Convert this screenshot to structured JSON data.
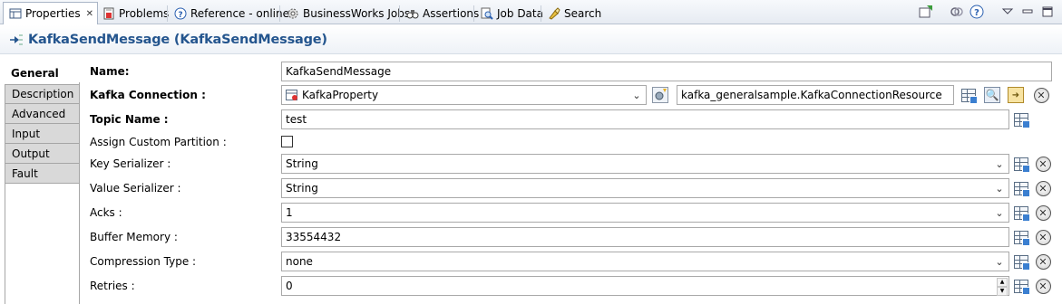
{
  "tabs": [
    {
      "label": "Properties",
      "icon": "properties-icon",
      "active": true
    },
    {
      "label": "Problems",
      "icon": "problems-icon"
    },
    {
      "label": "Reference - online",
      "icon": "help-icon"
    },
    {
      "label": "BusinessWorks Jobs",
      "icon": "gear-icon"
    },
    {
      "label": "Assertions",
      "icon": "binoculars-icon"
    },
    {
      "label": "Job Data",
      "icon": "magnifier-icon"
    },
    {
      "label": "Search",
      "icon": "flashlight-icon"
    }
  ],
  "header": {
    "title": "KafkaSendMessage (KafkaSendMessage)"
  },
  "sidebar": {
    "items": [
      {
        "label": "General",
        "active": true
      },
      {
        "label": "Description"
      },
      {
        "label": "Advanced"
      },
      {
        "label": "Input"
      },
      {
        "label": "Output"
      },
      {
        "label": "Fault"
      }
    ]
  },
  "form": {
    "name": {
      "label": "Name:",
      "value": "KafkaSendMessage"
    },
    "kafka_connection": {
      "label": "Kafka Connection :",
      "value": "KafkaProperty",
      "resource": "kafka_generalsample.KafkaConnectionResource"
    },
    "topic_name": {
      "label": "Topic Name :",
      "value": "test"
    },
    "assign_custom_partition": {
      "label": "Assign Custom Partition :",
      "checked": false
    },
    "key_serializer": {
      "label": "Key Serializer :",
      "value": "String"
    },
    "value_serializer": {
      "label": "Value Serializer :",
      "value": "String"
    },
    "acks": {
      "label": "Acks :",
      "value": "1"
    },
    "buffer_memory": {
      "label": "Buffer Memory :",
      "value": "33554432"
    },
    "compression_type": {
      "label": "Compression Type :",
      "value": "none"
    },
    "retries": {
      "label": "Retries :",
      "value": "0"
    }
  },
  "colors": {
    "title": "#24558e",
    "tab_border": "#a9b5c6"
  }
}
